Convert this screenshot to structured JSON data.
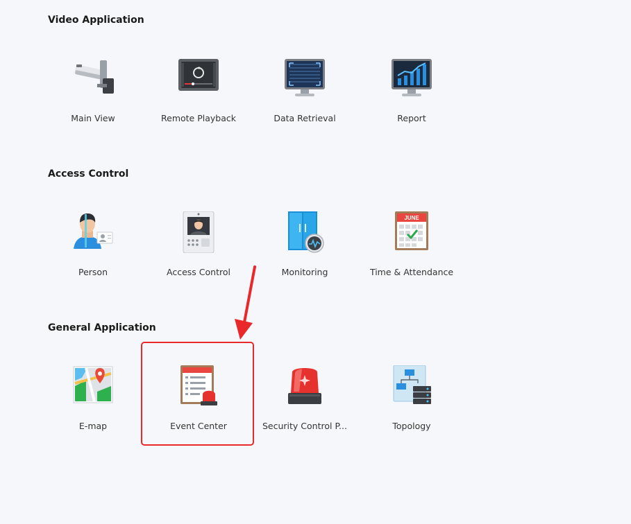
{
  "sections": [
    {
      "title": "Video Application",
      "items": [
        {
          "label": "Main View",
          "icon": "camera-icon"
        },
        {
          "label": "Remote Playback",
          "icon": "playback-icon"
        },
        {
          "label": "Data Retrieval",
          "icon": "data-retrieval-icon"
        },
        {
          "label": "Report",
          "icon": "report-chart-icon"
        }
      ]
    },
    {
      "title": "Access Control",
      "items": [
        {
          "label": "Person",
          "icon": "person-icon"
        },
        {
          "label": "Access Control",
          "icon": "access-terminal-icon"
        },
        {
          "label": "Monitoring",
          "icon": "door-monitoring-icon"
        },
        {
          "label": "Time & Attendance",
          "icon": "calendar-icon",
          "calendar_month": "JUNE"
        }
      ]
    },
    {
      "title": "General Application",
      "items": [
        {
          "label": "E-map",
          "icon": "map-pin-icon"
        },
        {
          "label": "Event Center",
          "icon": "event-center-icon"
        },
        {
          "label": "Security Control P...",
          "icon": "alarm-light-icon"
        },
        {
          "label": "Topology",
          "icon": "topology-icon"
        }
      ]
    }
  ],
  "colors": {
    "highlight": "#e8282a",
    "accent_blue": "#2b8fe0"
  }
}
